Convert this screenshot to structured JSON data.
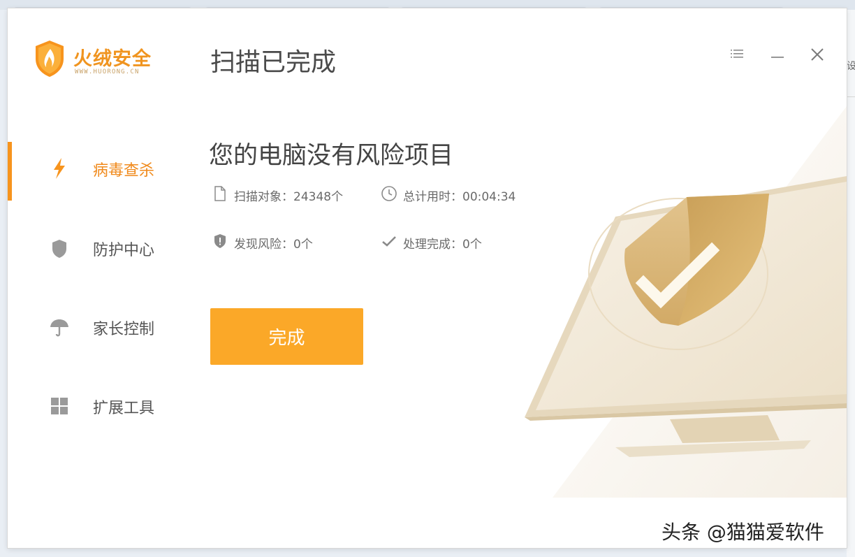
{
  "app": {
    "name": "火绒安全",
    "url": "WWW.HUORONG.CN",
    "accent_color": "#f7941d"
  },
  "header": {
    "title": "扫描已完成"
  },
  "window_controls": [
    {
      "name": "menu",
      "icon": "list-menu-icon"
    },
    {
      "name": "minimize",
      "icon": "minimize-icon"
    },
    {
      "name": "close",
      "icon": "close-icon"
    }
  ],
  "sidebar": {
    "items": [
      {
        "label": "病毒查杀",
        "icon": "lightning-icon",
        "active": true
      },
      {
        "label": "防护中心",
        "icon": "shield-icon",
        "active": false
      },
      {
        "label": "家长控制",
        "icon": "umbrella-icon",
        "active": false
      },
      {
        "label": "扩展工具",
        "icon": "grid-icon",
        "active": false
      }
    ]
  },
  "result": {
    "headline": "您的电脑没有风险项目",
    "stats": {
      "scan_objects": "扫描对象：24348个",
      "total_time": "总计用时：00:04:34",
      "risks_found": "发现风险：0个",
      "handled": "处理完成：0个"
    },
    "done_label": "完成"
  },
  "watermark": "头条 @猫猫爱软件",
  "background_fragment": "设"
}
